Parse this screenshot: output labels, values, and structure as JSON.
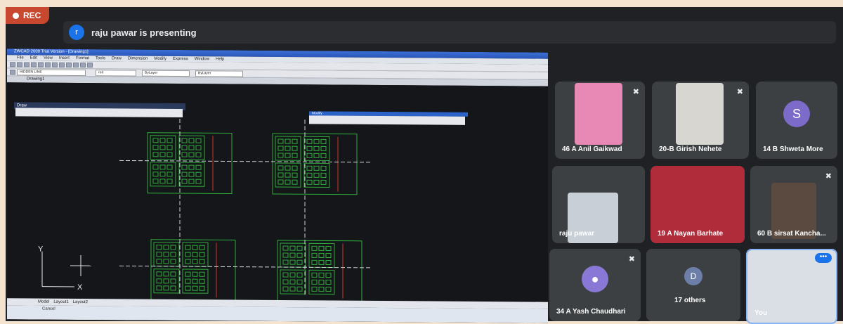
{
  "recording": {
    "label": "REC"
  },
  "presenter": {
    "initial": "r",
    "text": "raju pawar is presenting"
  },
  "cad": {
    "title": "ZWCAD 2009 Trial Version - [Drawing1]",
    "menu": [
      "File",
      "Edit",
      "View",
      "Insert",
      "Format",
      "Tools",
      "Draw",
      "Dimension",
      "Modify",
      "Express",
      "Window",
      "Help"
    ],
    "layer_name": "HIDDEN LINE",
    "color_name": "red",
    "linetype": "ByLayer",
    "lineweight": "ByLayer",
    "tab_drawing": "Drawing1",
    "toolbar_draw": "Draw",
    "toolbar_modify": "Modify",
    "layout_tabs": [
      "Model",
      "Layout1",
      "Layout2"
    ],
    "command": "Cancel",
    "axis_y": "Y",
    "axis_x": "X"
  },
  "participants": [
    {
      "name": "46 A Anil Gaikwad",
      "muted": true
    },
    {
      "name": "20-B Girish Nehete",
      "muted": true
    },
    {
      "name": "14 B Shweta More",
      "initial": "S"
    },
    {
      "name": "raju pawar"
    },
    {
      "name": "19 A Nayan Barhate"
    },
    {
      "name": "60 B sirsat Kancha...",
      "muted": true
    },
    {
      "name": "34 A Yash Chaudhari",
      "muted": true
    },
    {
      "name": "17 others",
      "initial": "D"
    },
    {
      "name": "You"
    }
  ],
  "colors": {
    "meet_bg": "#202124",
    "tile": "#3c4043",
    "drawing_green": "#2fae3a",
    "drawing_red": "#d1352b"
  }
}
